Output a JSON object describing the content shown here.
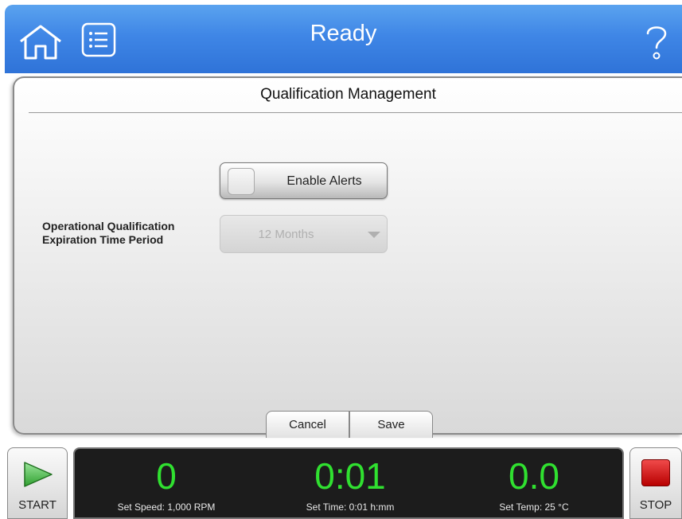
{
  "header": {
    "title": "Ready",
    "home_icon": "home-icon",
    "menu_icon": "list-icon",
    "help_icon": "question-mark-icon",
    "accent": "#3f86e6"
  },
  "panel": {
    "title": "Qualification Management",
    "enable_alerts_label": "Enable Alerts",
    "enable_alerts_checked": false,
    "oq_label_line1": "Operational Qualification",
    "oq_label_line2": "Expiration Time Period",
    "period_value": "12 Months",
    "period_disabled": true,
    "cancel_label": "Cancel",
    "save_label": "Save"
  },
  "footer": {
    "start_label": "START",
    "stop_label": "STOP",
    "speed_value": "0",
    "speed_set": "Set Speed: 1,000 RPM",
    "time_value": "0:01",
    "time_set": "Set Time: 0:01 h:mm",
    "temp_value": "0.0",
    "temp_set": "Set Temp: 25 °C",
    "readout_color": "#30e030",
    "stop_color": "#d00000",
    "start_color": "#3bb83b"
  }
}
